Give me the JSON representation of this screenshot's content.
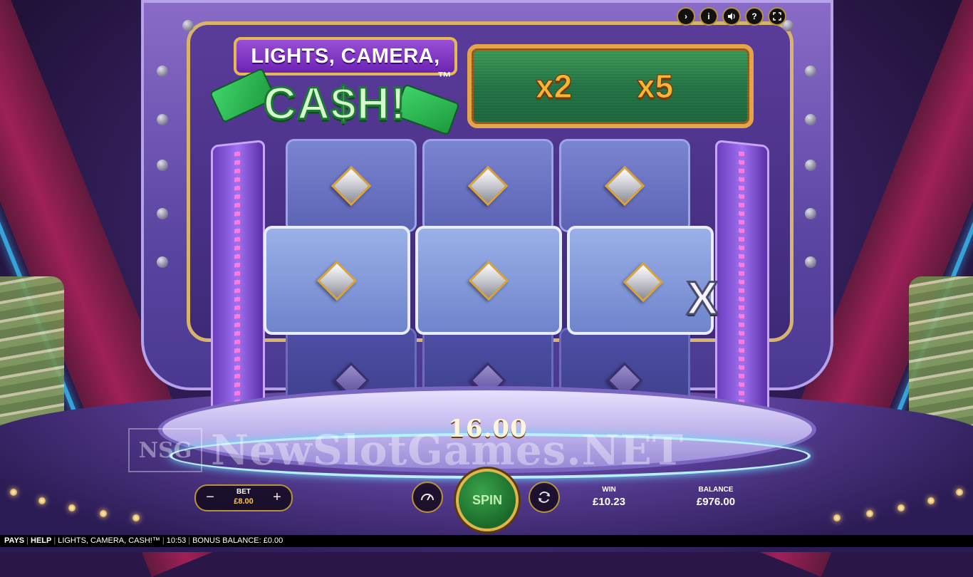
{
  "game": {
    "logo_line1": "LIGHTS, CAMERA,",
    "logo_line2": "CA$H!",
    "logo_tm": "™"
  },
  "multiplier_strip": {
    "items": [
      "x2",
      "x5"
    ]
  },
  "board": {
    "x_mark": "X",
    "win_amount": "16.00"
  },
  "watermark": {
    "logo": "NSG",
    "text": "NewSlotGames.NET"
  },
  "controls": {
    "bet_label": "BET",
    "bet_value": "£8.00",
    "bet_minus": "−",
    "bet_plus": "+",
    "spin_label": "SPIN",
    "win_label": "WIN",
    "win_value": "£10.23",
    "balance_label": "BALANCE",
    "balance_value": "£976.00"
  },
  "top_icons": [
    "play-icon",
    "info-icon",
    "sound-icon",
    "help-icon",
    "fullscreen-icon"
  ],
  "footer": {
    "pays": "PAYS",
    "help": "HELP",
    "game_name": "LIGHTS, CAMERA, CASH!™",
    "time": "10:53",
    "bonus_balance": "BONUS BALANCE: £0.00"
  }
}
